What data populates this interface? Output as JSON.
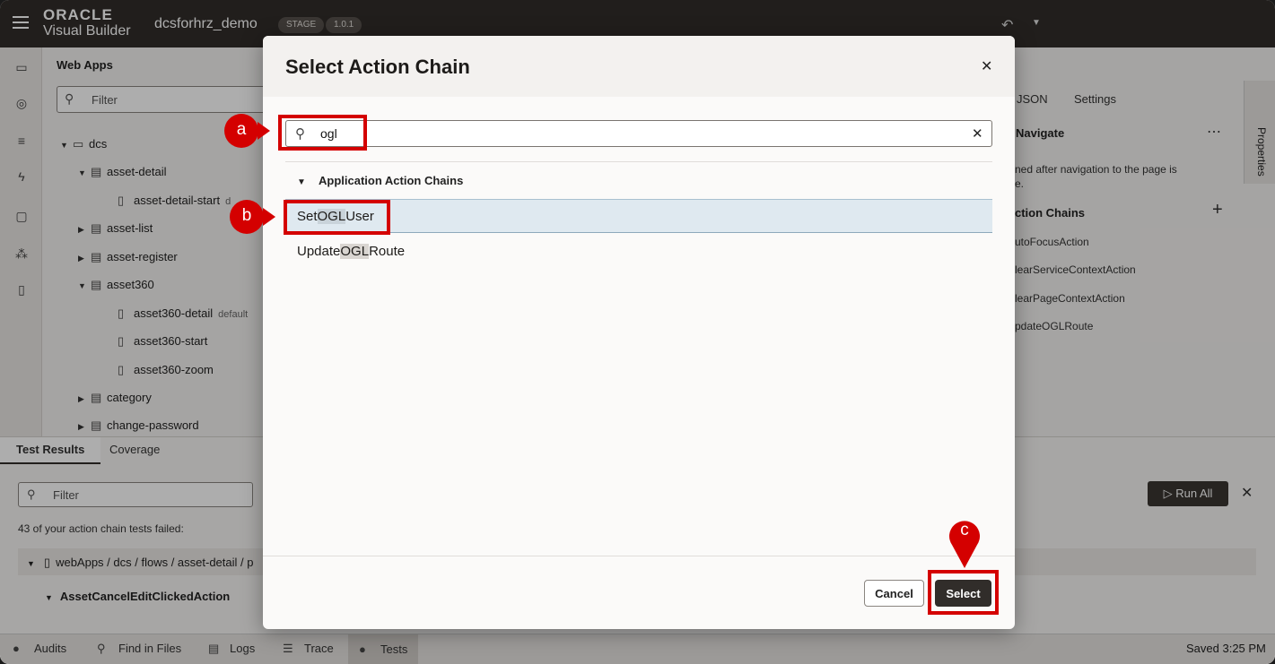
{
  "topbar": {
    "logo_line1": "ORACLE",
    "logo_line2": "Visual Builder",
    "project": "dcsforhrz_demo",
    "badge_stage": "STAGE",
    "badge_version": "1.0.1"
  },
  "nav": {
    "title": "Web Apps",
    "filter_placeholder": "Filter",
    "items": [
      {
        "label": "dcs"
      },
      {
        "label": "asset-detail"
      },
      {
        "label": "asset-detail-start",
        "tag": "d"
      },
      {
        "label": "asset-list"
      },
      {
        "label": "asset-register"
      },
      {
        "label": "asset360"
      },
      {
        "label": "asset360-detail",
        "tag": "default"
      },
      {
        "label": "asset360-start"
      },
      {
        "label": "asset360-zoom"
      },
      {
        "label": "category"
      },
      {
        "label": "change-password"
      }
    ]
  },
  "right_panel": {
    "tab_json": "JSON",
    "tab_settings": "Settings",
    "heading": "Navigate",
    "desc_line1": "ned after navigation to the page is",
    "desc_line2": "e.",
    "chains_heading": "ction Chains",
    "chains": [
      "utoFocusAction",
      "learServiceContextAction",
      "learPageContextAction",
      "pdateOGLRoute"
    ],
    "side_tab": "Properties"
  },
  "bottom": {
    "tab_results": "Test Results",
    "tab_coverage": "Coverage",
    "filter_placeholder": "Filter",
    "message": "43 of your action chain tests failed:",
    "row_path": "webApps / dcs / flows / asset-detail / p",
    "row_action": "AssetCancelEditClickedAction",
    "run_all": "Run All"
  },
  "statusbar": {
    "audits": "Audits",
    "find": "Find in Files",
    "logs": "Logs",
    "trace": "Trace",
    "tests": "Tests",
    "saved": "Saved 3:25 PM"
  },
  "dialog": {
    "title": "Select Action Chain",
    "search_value": "ogl",
    "group": "Application Action Chains",
    "items": [
      {
        "pre": "Set",
        "match": "OGL",
        "post": "User"
      },
      {
        "pre": "Update",
        "match": "OGL",
        "post": "Route"
      }
    ],
    "cancel": "Cancel",
    "select": "Select"
  },
  "annotations": {
    "a": "a",
    "b": "b",
    "c": "c",
    "color": "#d40000"
  }
}
